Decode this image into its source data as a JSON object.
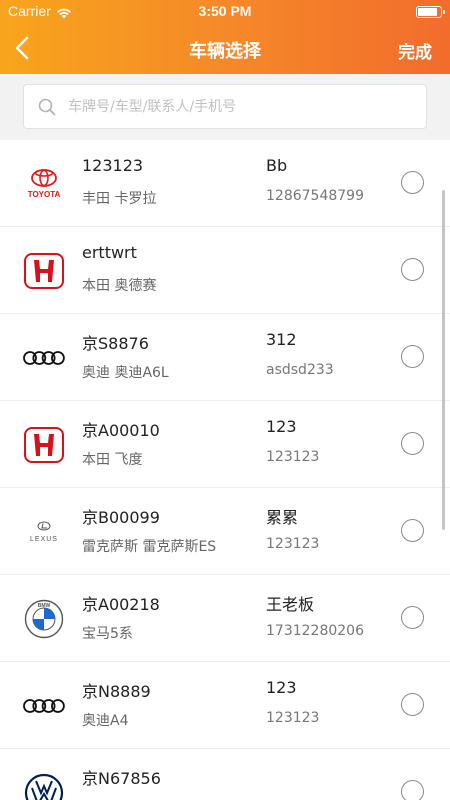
{
  "status_bar": {
    "carrier": "Carrier",
    "time": "3:50 PM"
  },
  "nav": {
    "title": "车辆选择",
    "done_label": "完成"
  },
  "search": {
    "placeholder": "车牌号/车型/联系人/手机号",
    "value": ""
  },
  "colors": {
    "header_start": "#f8a51c",
    "header_end": "#f26c2c"
  },
  "vehicles": [
    {
      "logo": "toyota-logo",
      "logo_text": "TOYOTA",
      "plate": "123123",
      "model": "丰田 卡罗拉",
      "contact": "Bb",
      "phone": "12867548799",
      "selected": false
    },
    {
      "logo": "honda-logo",
      "plate": "erttwrt",
      "model": "本田 奥德赛",
      "contact": "",
      "phone": "",
      "selected": false
    },
    {
      "logo": "audi-logo",
      "plate": "京S8876",
      "model": "奥迪 奥迪A6L",
      "contact": "312",
      "phone": "asdsd233",
      "selected": false
    },
    {
      "logo": "honda-logo",
      "plate": "京A00010",
      "model": "本田 飞度",
      "contact": "123",
      "phone": "123123",
      "selected": false
    },
    {
      "logo": "lexus-logo",
      "logo_text": "LEXUS",
      "plate": "京B00099",
      "model": "雷克萨斯 雷克萨斯ES",
      "contact": "累累",
      "phone": "123123",
      "selected": false
    },
    {
      "logo": "bmw-logo",
      "logo_text": "BMW",
      "plate": "京A00218",
      "model": "宝马5系",
      "contact": "王老板",
      "phone": "17312280206",
      "selected": false
    },
    {
      "logo": "audi-logo",
      "plate": "京N8889",
      "model": "奥迪A4",
      "contact": "123",
      "phone": "123123",
      "selected": false
    },
    {
      "logo": "volkswagen-logo",
      "plate": "京N67856",
      "model": "",
      "contact": "",
      "phone": "",
      "selected": false
    }
  ]
}
